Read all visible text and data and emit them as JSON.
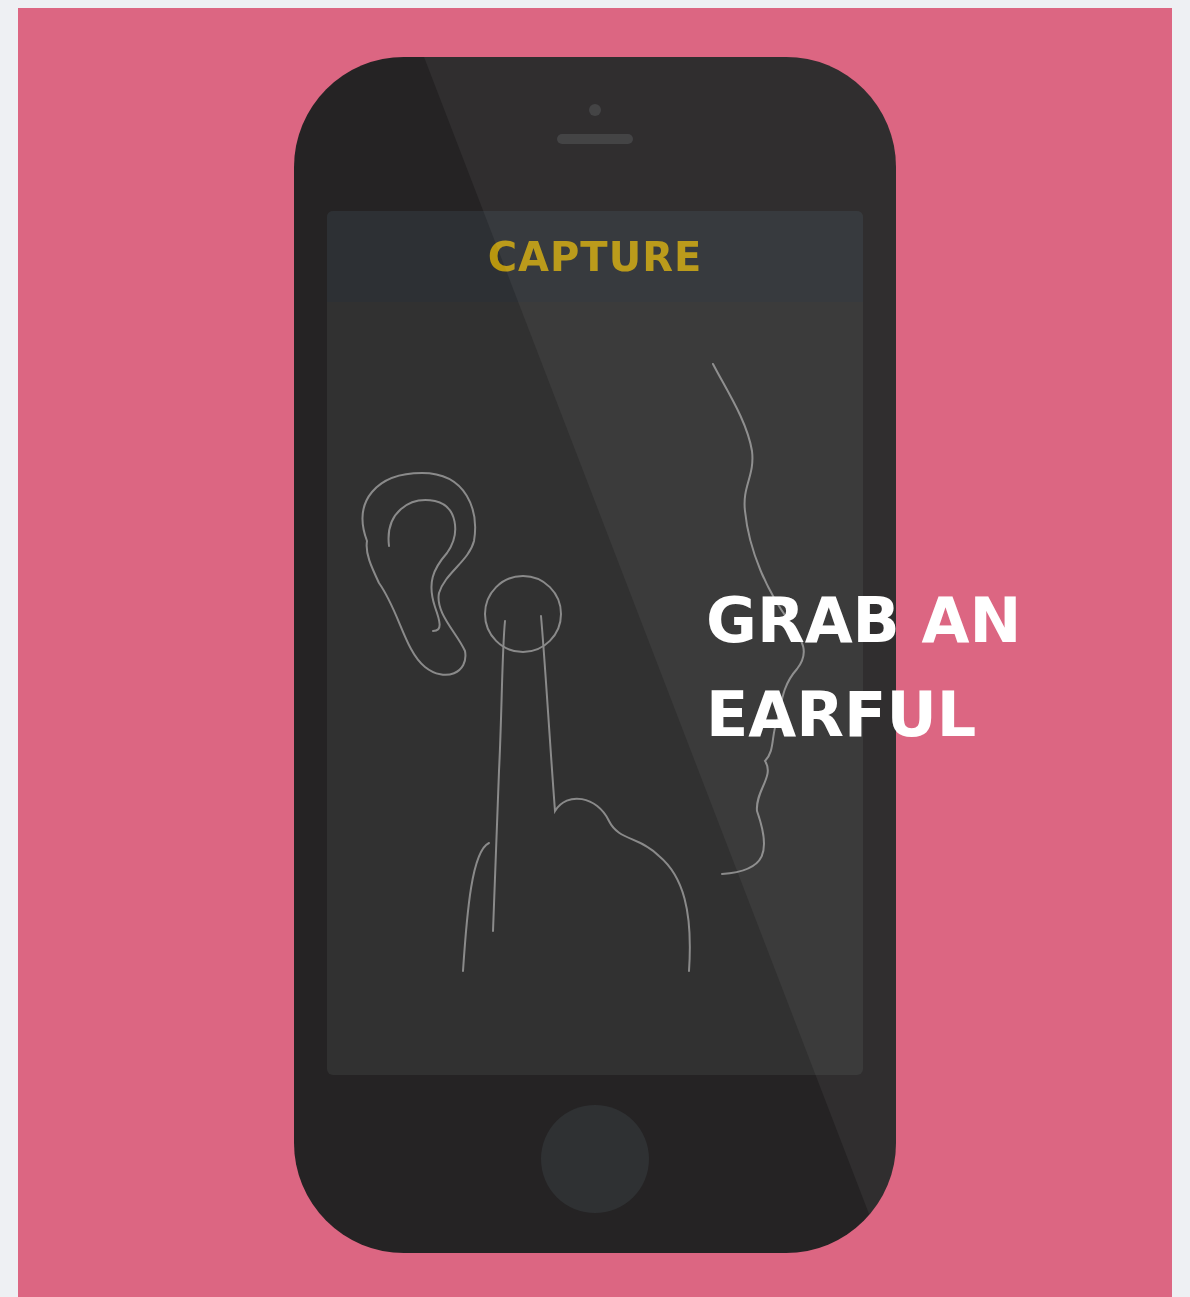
{
  "screen": {
    "header": "CAPTURE"
  },
  "headline": "GRAB AN EARFUL"
}
